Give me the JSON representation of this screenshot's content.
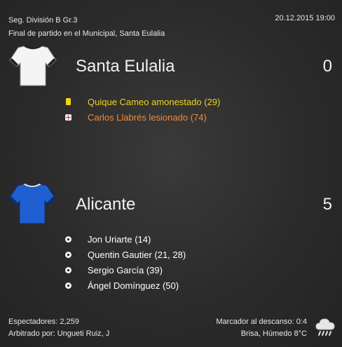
{
  "header": {
    "competition": "Seg. División B Gr.3",
    "datetime": "20.12.2015 19:00",
    "summary": "Final de partido en el Municipal, Santa Eulalia"
  },
  "home": {
    "name": "Santa Eulalia",
    "score": "0",
    "shirt_icon": "white-shirt-icon",
    "events": [
      {
        "icon": "yellow-card-icon",
        "text": "Quique Cameo amonestado (29)",
        "color": "#f2d21b"
      },
      {
        "icon": "injury-icon",
        "text": "Carlos Llabrés lesionado (74)",
        "color": "#f08a3c"
      }
    ]
  },
  "away": {
    "name": "Alicante",
    "score": "5",
    "shirt_icon": "blue-shirt-icon",
    "events": [
      {
        "icon": "goal-ball-icon",
        "text": "Jon Uriarte (14)",
        "color": "#ffffff"
      },
      {
        "icon": "goal-ball-icon",
        "text": "Quentin Gautier (21, 28)",
        "color": "#ffffff"
      },
      {
        "icon": "goal-ball-icon",
        "text": "Sergio García (39)",
        "color": "#ffffff"
      },
      {
        "icon": "goal-ball-icon",
        "text": "Ángel Domínguez (50)",
        "color": "#ffffff"
      }
    ]
  },
  "footer": {
    "attendance": "Espectadores: 2,259",
    "referee": "Arbitrado por: Ungueti Ruiz, J",
    "halftime": "Marcador al descanso: 0:4",
    "weather": "Brisa, Húmedo 8°C",
    "weather_icon": "rain-cloud-icon"
  }
}
